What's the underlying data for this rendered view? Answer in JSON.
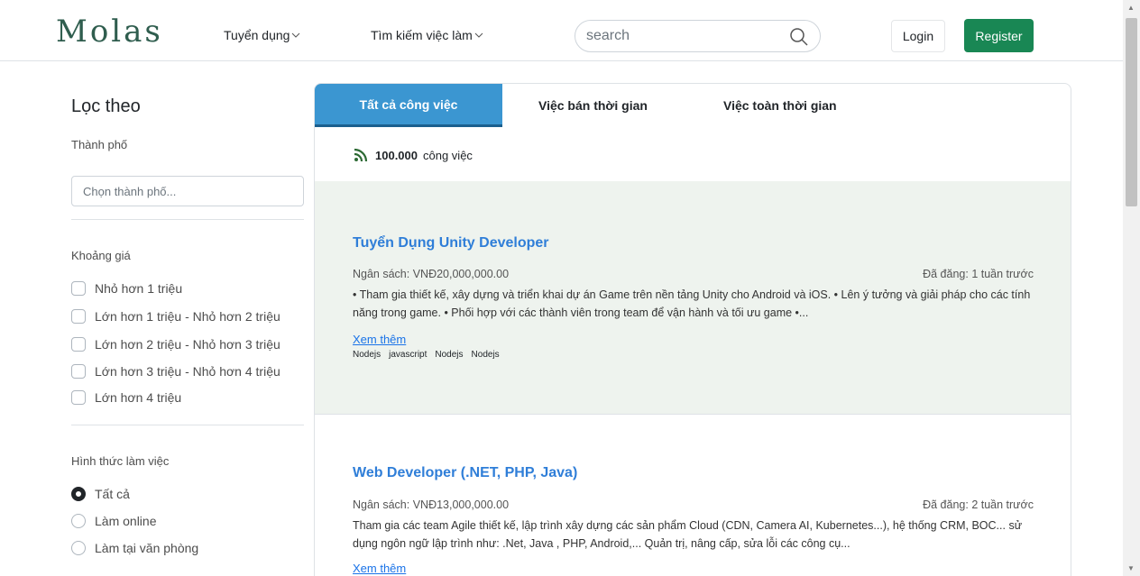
{
  "header": {
    "logo": "Molas",
    "nav": [
      {
        "label": "Tuyển dụng"
      },
      {
        "label": "Tìm kiếm việc làm"
      }
    ],
    "search_placeholder": "search",
    "login_label": "Login",
    "register_label": "Register"
  },
  "sidebar": {
    "title": "Lọc theo",
    "city_label": "Thành phố",
    "city_placeholder": "Chọn thành phố...",
    "price_label": "Khoảng giá",
    "price_options": [
      "Nhỏ hơn 1 triệu",
      "Lớn hơn 1 triệu - Nhỏ hơn 2 triệu",
      "Lớn hơn 2 triệu - Nhỏ hơn 3 triệu",
      "Lớn hơn 3 triệu - Nhỏ hơn 4 triệu",
      "Lớn hơn 4 triệu"
    ],
    "work_label": "Hình thức làm việc",
    "work_options": [
      {
        "label": "Tất cả",
        "checked": true
      },
      {
        "label": "Làm online",
        "checked": false
      },
      {
        "label": "Làm tại văn phòng",
        "checked": false
      }
    ]
  },
  "main": {
    "tabs": [
      {
        "label": "Tất cả công việc",
        "active": true
      },
      {
        "label": "Việc bán thời gian",
        "active": false
      },
      {
        "label": "Việc toàn thời gian",
        "active": false
      }
    ],
    "count_number": "100.000",
    "count_suffix": "công việc",
    "jobs": [
      {
        "title": "Tuyển Dụng Unity Developer",
        "budget": "Ngân sách: VNĐ20,000,000.00",
        "posted": "Đã đăng: 1 tuần trước",
        "description": "• Tham gia thiết kế, xây dựng và triển khai dự án Game trên nền tảng Unity cho Android và iOS. • Lên ý tưởng và giải pháp cho các tính năng trong game. • Phối hợp với các thành viên trong team để vận hành và tối ưu game •...",
        "more": "Xem thêm",
        "tags": [
          "Nodejs",
          "javascript",
          "Nodejs",
          "Nodejs"
        ]
      },
      {
        "title": "Web Developer (.NET, PHP, Java)",
        "budget": "Ngân sách: VNĐ13,000,000.00",
        "posted": "Đã đăng: 2 tuần trước",
        "description": "Tham gia các team Agile thiết kế, lập trình xây dựng các sản phẩm Cloud (CDN, Camera AI, Kubernetes...), hệ thống CRM, BOC... sử dụng ngôn ngữ lập trình như: .Net, Java , PHP, Android,... Quản trị, nâng cấp, sửa lỗi các công cụ...",
        "more": "Xem thêm",
        "tags": []
      }
    ]
  },
  "colors": {
    "brand": "#2f5d4e",
    "register": "#198754",
    "active_tab": "#3b96d1",
    "link": "#2f7ed8",
    "highlight_bg": "#eef3ee"
  }
}
